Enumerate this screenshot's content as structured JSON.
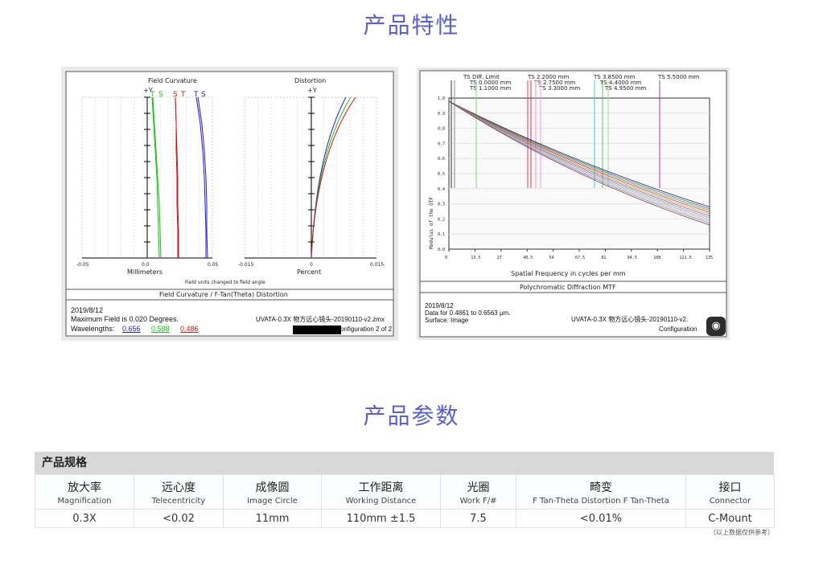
{
  "section1_title": "产品特性",
  "section2_title": "产品参数",
  "field_chart": {
    "fc_title": "Field Curvature",
    "dist_title": "Distortion",
    "plus_y": "+Y",
    "fc_legend": [
      "T",
      "S",
      "S",
      "T",
      "T",
      "S"
    ],
    "fc_ticks": [
      "-0.05",
      "0.0",
      "0.05"
    ],
    "fc_xlabel": "Millimeters",
    "dist_ticks": [
      "-0.015",
      "0",
      "0.015"
    ],
    "dist_xlabel": "Percent",
    "note": "Field units changed to field angle",
    "caption": "Field Curvature / F-Tan(Theta) Distortion",
    "date": "2019/8/12",
    "max_field": "Maximum Field is 0.020 Degrees.",
    "wavelength_label": "Wavelengths:",
    "wavelengths": [
      "0.656",
      "0.588",
      "0.486"
    ],
    "file": "UVATA-0.3X 物方远心镜头-20190110-v2.zmx",
    "config": "onfiguration 2 of 2",
    "colors": {
      "blue": "#1b1bd6",
      "green": "#19c019",
      "red": "#d01616"
    }
  },
  "mtf_chart": {
    "legend": [
      "TS Diff. Limit",
      "TS 0.0000 mm",
      "TS 1.1000 mm",
      "TS 2.2000 mm",
      "TS 2.7500 mm",
      "TS 3.3000 mm",
      "TS 3.8500 mm",
      "TS 4.4000 mm",
      "TS 4.9500 mm",
      "TS 5.5000 mm"
    ],
    "ylabel": "Modulus of the OTF",
    "yticks": [
      "1.0",
      "0.9",
      "0.8",
      "0.7",
      "0.6",
      "0.5",
      "0.4",
      "0.3",
      "0.2",
      "0.1",
      "0.0"
    ],
    "xticks": [
      "0",
      "13.5",
      "27",
      "40.5",
      "54",
      "67.5",
      "81",
      "94.5",
      "108",
      "121.5",
      "135"
    ],
    "xlabel": "Spatial Frequency in cycles per mm",
    "caption": "Polychromatic Diffraction MTF",
    "date": "2019/8/12",
    "data_line": "Data for 0.4861 to 0.6563 µm.",
    "surface": "Surface: Image",
    "file": "UVATA-0.3X 物方远心镜头-20190110-v2.",
    "config": "Configuration",
    "camera_icon": "camera-icon"
  },
  "spec": {
    "header": "产品规格",
    "columns": [
      {
        "zh": "放大率",
        "en": "Magnification"
      },
      {
        "zh": "远心度",
        "en": "Telecentricity"
      },
      {
        "zh": "成像圆",
        "en": "Image Circle"
      },
      {
        "zh": "工作距离",
        "en": "Working Distance"
      },
      {
        "zh": "光圈",
        "en": "Work F/#"
      },
      {
        "zh": "畸变",
        "en": "F Tan-Theta Distortion F Tan-Theta"
      },
      {
        "zh": "接口",
        "en": "Connector"
      }
    ],
    "row": [
      "0.3X",
      "<0.02",
      "11mm",
      "110mm ±1.5",
      "7.5",
      "<0.01%",
      "C-Mount"
    ],
    "note": "（以上数据仅供参考）"
  }
}
